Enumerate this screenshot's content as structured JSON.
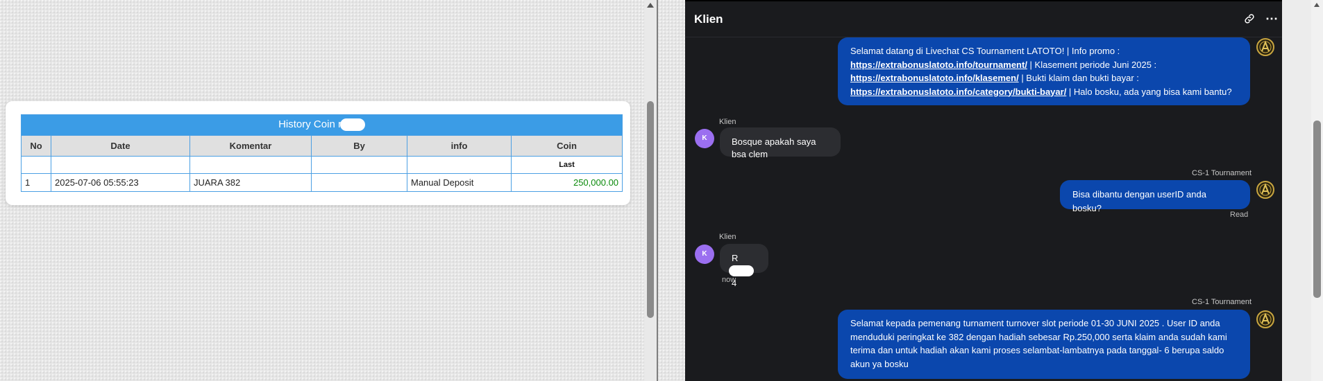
{
  "history": {
    "title_prefix": "History Coin r",
    "columns": [
      "No",
      "Date",
      "Komentar",
      "By",
      "info",
      "Coin"
    ],
    "sub_header": "Last",
    "rows": [
      {
        "no": "1",
        "date": "2025-07-06 05:55:23",
        "komentar": "JUARA 382",
        "by": "",
        "info": "Manual Deposit",
        "coin": "250,000.00"
      }
    ]
  },
  "chat": {
    "title": "Klien",
    "icons": {
      "link": "link-icon",
      "more": "more-icon",
      "avatar": "agent-logo-icon"
    },
    "more_glyph": "⋯",
    "messages": [
      {
        "sender": "agent",
        "lines": {
          "l1": "Selamat datang di Livechat CS Tournament LATOTO! | Info promo :",
          "link1": "https://extrabonuslatoto.info/tournament/",
          "t2": " | Klasement periode Juni 2025 :",
          "link2": "https://extrabonuslatoto.info/klasemen/",
          "t3": " | Bukti klaim dan bukti bayar :",
          "link3": "https://extrabonuslatoto.info/category/bukti-bayar/",
          "t4": " | Halo bosku, ada yang bisa kami bantu?"
        }
      },
      {
        "sender": "client",
        "name": "Klien",
        "avatar_letter": "K",
        "text": "Bosque apakah saya bsa clem"
      },
      {
        "sender": "agent",
        "name": "CS-1 Tournament",
        "text": "Bisa dibantu dengan userID anda bosku?",
        "status": "Read"
      },
      {
        "sender": "client",
        "name": "Klien",
        "avatar_letter": "K",
        "text_prefix": "R",
        "text_suffix": "4",
        "time": "now"
      },
      {
        "sender": "agent",
        "name": "CS-1 Tournament",
        "lines": [
          "Selamat kepada pemenang turnament turnover slot periode 01-30 JUNI 2025 . User ID anda",
          "menduduki peringkat ke 382 dengan hadiah sebesar Rp.250,000 serta klaim anda sudah kami",
          "terima dan untuk hadiah akan kami proses selambat-lambatnya pada tanggal- 6 berupa saldo",
          "akun ya bosku"
        ]
      }
    ]
  },
  "colors": {
    "table_header_blue": "#3b9ce6",
    "coin_green": "#0a8a0a",
    "chat_bg": "#1a1b1e",
    "agent_bubble": "#0b47ad",
    "client_bubble": "#2c2d31",
    "client_avatar": "#9b6ff0"
  }
}
